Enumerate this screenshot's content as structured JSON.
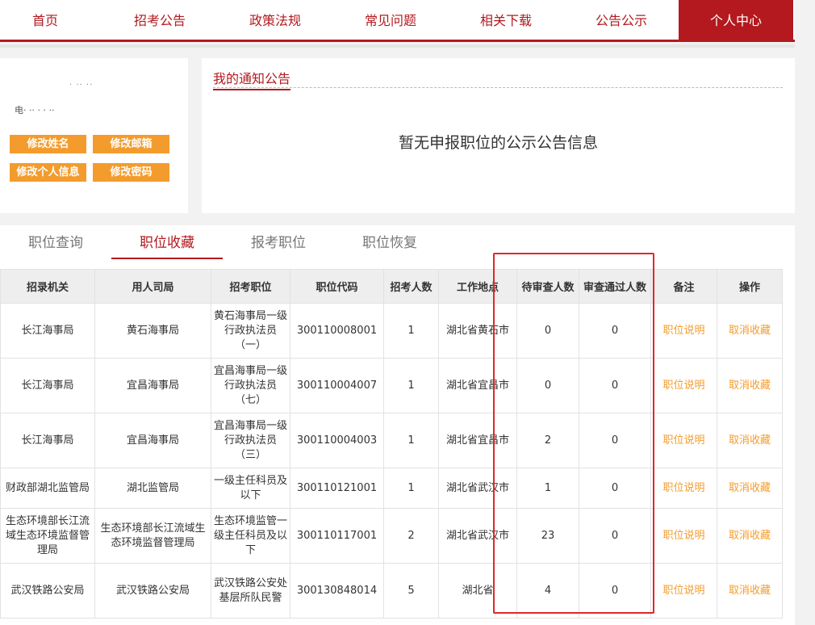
{
  "nav": {
    "items": [
      "首页",
      "招考公告",
      "政策法规",
      "常见问题",
      "相关下载",
      "公告公示",
      "个人中心"
    ]
  },
  "profile": {
    "name_blur": "· ·· ··",
    "info_blur": "电· ·· · · ··",
    "buttons": [
      "修改姓名",
      "修改邮箱",
      "修改个人信息",
      "修改密码"
    ]
  },
  "notice": {
    "title": "我的通知公告",
    "message": "暂无申报职位的公示公告信息"
  },
  "tabs": [
    "职位查询",
    "职位收藏",
    "报考职位",
    "职位恢复"
  ],
  "table": {
    "headers": [
      "招录机关",
      "用人司局",
      "招考职位",
      "职位代码",
      "招考人数",
      "工作地点",
      "待审查人数",
      "审查通过人数",
      "备注",
      "操作"
    ],
    "rows": [
      [
        "长江海事局",
        "黄石海事局",
        "黄石海事局一级行政执法员（一）",
        "300110008001",
        "1",
        "湖北省黄石市",
        "0",
        "0",
        "职位说明",
        "取消收藏"
      ],
      [
        "长江海事局",
        "宜昌海事局",
        "宜昌海事局一级行政执法员（七）",
        "300110004007",
        "1",
        "湖北省宜昌市",
        "0",
        "0",
        "职位说明",
        "取消收藏"
      ],
      [
        "长江海事局",
        "宜昌海事局",
        "宜昌海事局一级行政执法员（三）",
        "300110004003",
        "1",
        "湖北省宜昌市",
        "2",
        "0",
        "职位说明",
        "取消收藏"
      ],
      [
        "财政部湖北监管局",
        "湖北监管局",
        "一级主任科员及以下",
        "300110121001",
        "1",
        "湖北省武汉市",
        "1",
        "0",
        "职位说明",
        "取消收藏"
      ],
      [
        "生态环境部长江流域生态环境监督管理局",
        "生态环境部长江流域生态环境监督管理局",
        "生态环境监管一级主任科员及以下",
        "300110117001",
        "2",
        "湖北省武汉市",
        "23",
        "0",
        "职位说明",
        "取消收藏"
      ],
      [
        "武汉铁路公安局",
        "武汉铁路公安局",
        "武汉铁路公安处基层所队民警",
        "300130848014",
        "5",
        "湖北省",
        "4",
        "0",
        "职位说明",
        "取消收藏"
      ]
    ]
  },
  "colors": {
    "brand": "#b3191e",
    "accent": "#f39c2d",
    "highlight": "#e0282b"
  }
}
